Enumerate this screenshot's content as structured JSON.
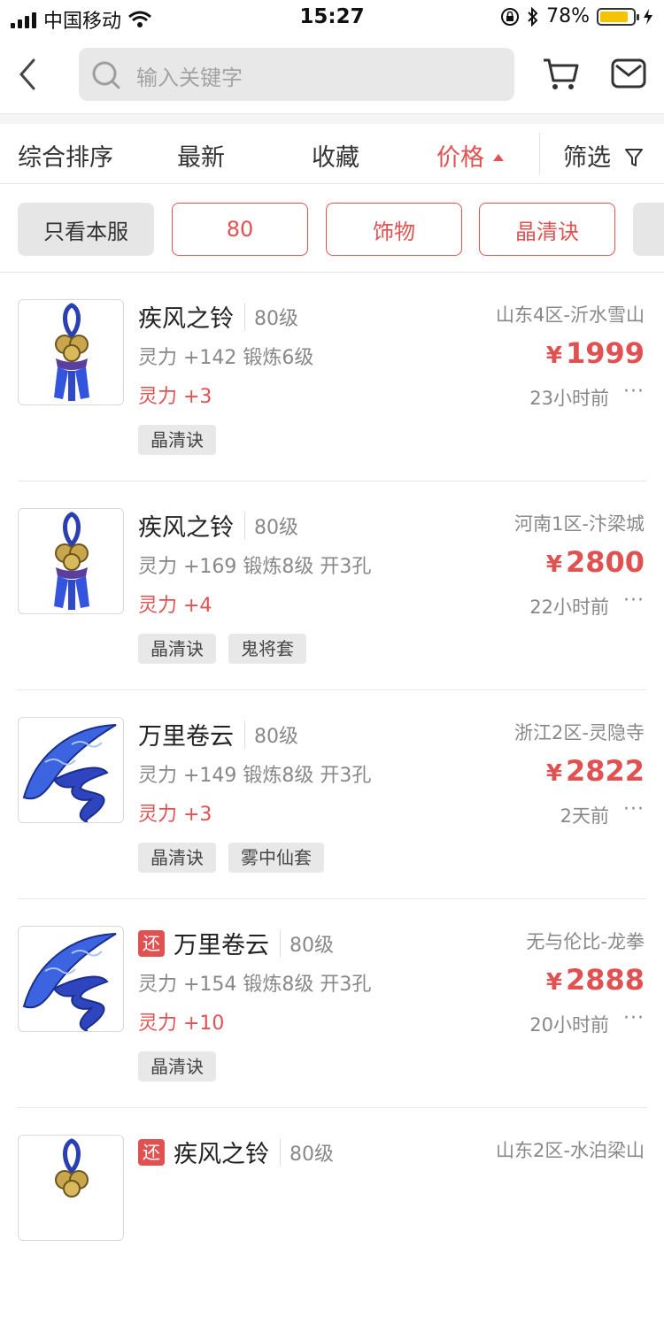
{
  "status_bar": {
    "carrier": "中国移动",
    "time": "15:27",
    "battery": "78%"
  },
  "search": {
    "placeholder": "输入关键字"
  },
  "sort_options": [
    {
      "label": "综合排序"
    },
    {
      "label": "最新"
    },
    {
      "label": "收藏"
    },
    {
      "label": "价格"
    },
    {
      "label": "筛选"
    }
  ],
  "filter_chips": [
    {
      "label": "只看本服"
    },
    {
      "label": "80"
    },
    {
      "label": "饰物"
    },
    {
      "label": "晶清诀"
    }
  ],
  "items": [
    {
      "name": "疾风之铃",
      "level": "80级",
      "stat": "灵力 +142 锻炼6级",
      "bonus": "灵力 +3",
      "tags": [
        "晶清诀"
      ],
      "server": "山东4区-沂水雪山",
      "currency": "¥",
      "price": "1999",
      "time": "23小时前",
      "icon": "bell-ornament-icon",
      "returned": false
    },
    {
      "name": "疾风之铃",
      "level": "80级",
      "stat": "灵力 +169 锻炼8级 开3孔",
      "bonus": "灵力 +4",
      "tags": [
        "晶清诀",
        "鬼将套"
      ],
      "server": "河南1区-汴梁城",
      "currency": "¥",
      "price": "2800",
      "time": "22小时前",
      "icon": "bell-ornament-icon",
      "returned": false
    },
    {
      "name": "万里卷云",
      "level": "80级",
      "stat": "灵力 +149 锻炼8级 开3孔",
      "bonus": "灵力 +3",
      "tags": [
        "晶清诀",
        "雾中仙套"
      ],
      "server": "浙江2区-灵隐寺",
      "currency": "¥",
      "price": "2822",
      "time": "2天前",
      "icon": "ribbon-ornament-icon",
      "returned": false
    },
    {
      "name": "万里卷云",
      "level": "80级",
      "stat": "灵力 +154 锻炼8级 开3孔",
      "bonus": "灵力 +10",
      "tags": [
        "晶清诀"
      ],
      "server": "无与伦比-龙拳",
      "currency": "¥",
      "price": "2888",
      "time": "20小时前",
      "icon": "ribbon-ornament-icon",
      "returned": true,
      "returned_label": "还"
    },
    {
      "name": "疾风之铃",
      "level": "80级",
      "stat": "",
      "bonus": "",
      "tags": [],
      "server": "山东2区-水泊梁山",
      "currency": "",
      "price": "",
      "time": "",
      "icon": "bell-ornament-icon",
      "returned": true,
      "returned_label": "还"
    }
  ],
  "colors": {
    "accent": "#e05252",
    "chip_gray": "#e6e6e6"
  }
}
